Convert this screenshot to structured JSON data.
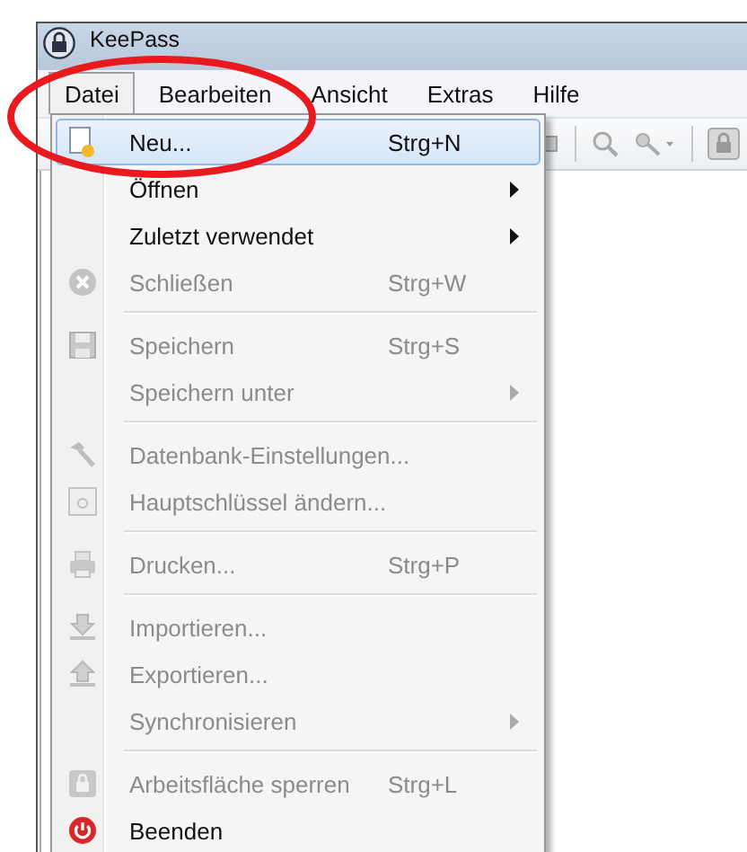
{
  "window": {
    "title": "KeePass"
  },
  "menu_bar": [
    {
      "label": "Datei",
      "selected": true
    },
    {
      "label": "Bearbeiten",
      "selected": false
    },
    {
      "label": "Ansicht",
      "selected": false
    },
    {
      "label": "Extras",
      "selected": false
    },
    {
      "label": "Hilfe",
      "selected": false
    }
  ],
  "file_menu": [
    {
      "kind": "item",
      "label": "Neu...",
      "shortcut": "Strg+N",
      "selected": true,
      "disabled": false,
      "submenu": false
    },
    {
      "kind": "item",
      "label": "Öffnen",
      "selected": false,
      "disabled": false,
      "submenu": true
    },
    {
      "kind": "item",
      "label": "Zuletzt verwendet",
      "selected": false,
      "disabled": false,
      "submenu": true
    },
    {
      "kind": "item",
      "label": "Schließen",
      "shortcut": "Strg+W",
      "selected": false,
      "disabled": true,
      "submenu": false
    },
    {
      "kind": "separator"
    },
    {
      "kind": "item",
      "label": "Speichern",
      "shortcut": "Strg+S",
      "selected": false,
      "disabled": true,
      "submenu": false
    },
    {
      "kind": "item",
      "label": "Speichern unter",
      "selected": false,
      "disabled": true,
      "submenu": true
    },
    {
      "kind": "separator"
    },
    {
      "kind": "item",
      "label": "Datenbank-Einstellungen...",
      "selected": false,
      "disabled": true,
      "submenu": false
    },
    {
      "kind": "item",
      "label": "Hauptschlüssel ändern...",
      "selected": false,
      "disabled": true,
      "submenu": false
    },
    {
      "kind": "separator"
    },
    {
      "kind": "item",
      "label": "Drucken...",
      "shortcut": "Strg+P",
      "selected": false,
      "disabled": true,
      "submenu": false
    },
    {
      "kind": "separator"
    },
    {
      "kind": "item",
      "label": "Importieren...",
      "selected": false,
      "disabled": true,
      "submenu": false
    },
    {
      "kind": "item",
      "label": "Exportieren...",
      "selected": false,
      "disabled": true,
      "submenu": false
    },
    {
      "kind": "item",
      "label": "Synchronisieren",
      "selected": false,
      "disabled": true,
      "submenu": true
    },
    {
      "kind": "separator"
    },
    {
      "kind": "item",
      "label": "Arbeitsfläche sperren",
      "shortcut": "Strg+L",
      "selected": false,
      "disabled": true,
      "submenu": false
    },
    {
      "kind": "item",
      "label": "Beenden",
      "selected": false,
      "disabled": false,
      "submenu": false
    }
  ]
}
